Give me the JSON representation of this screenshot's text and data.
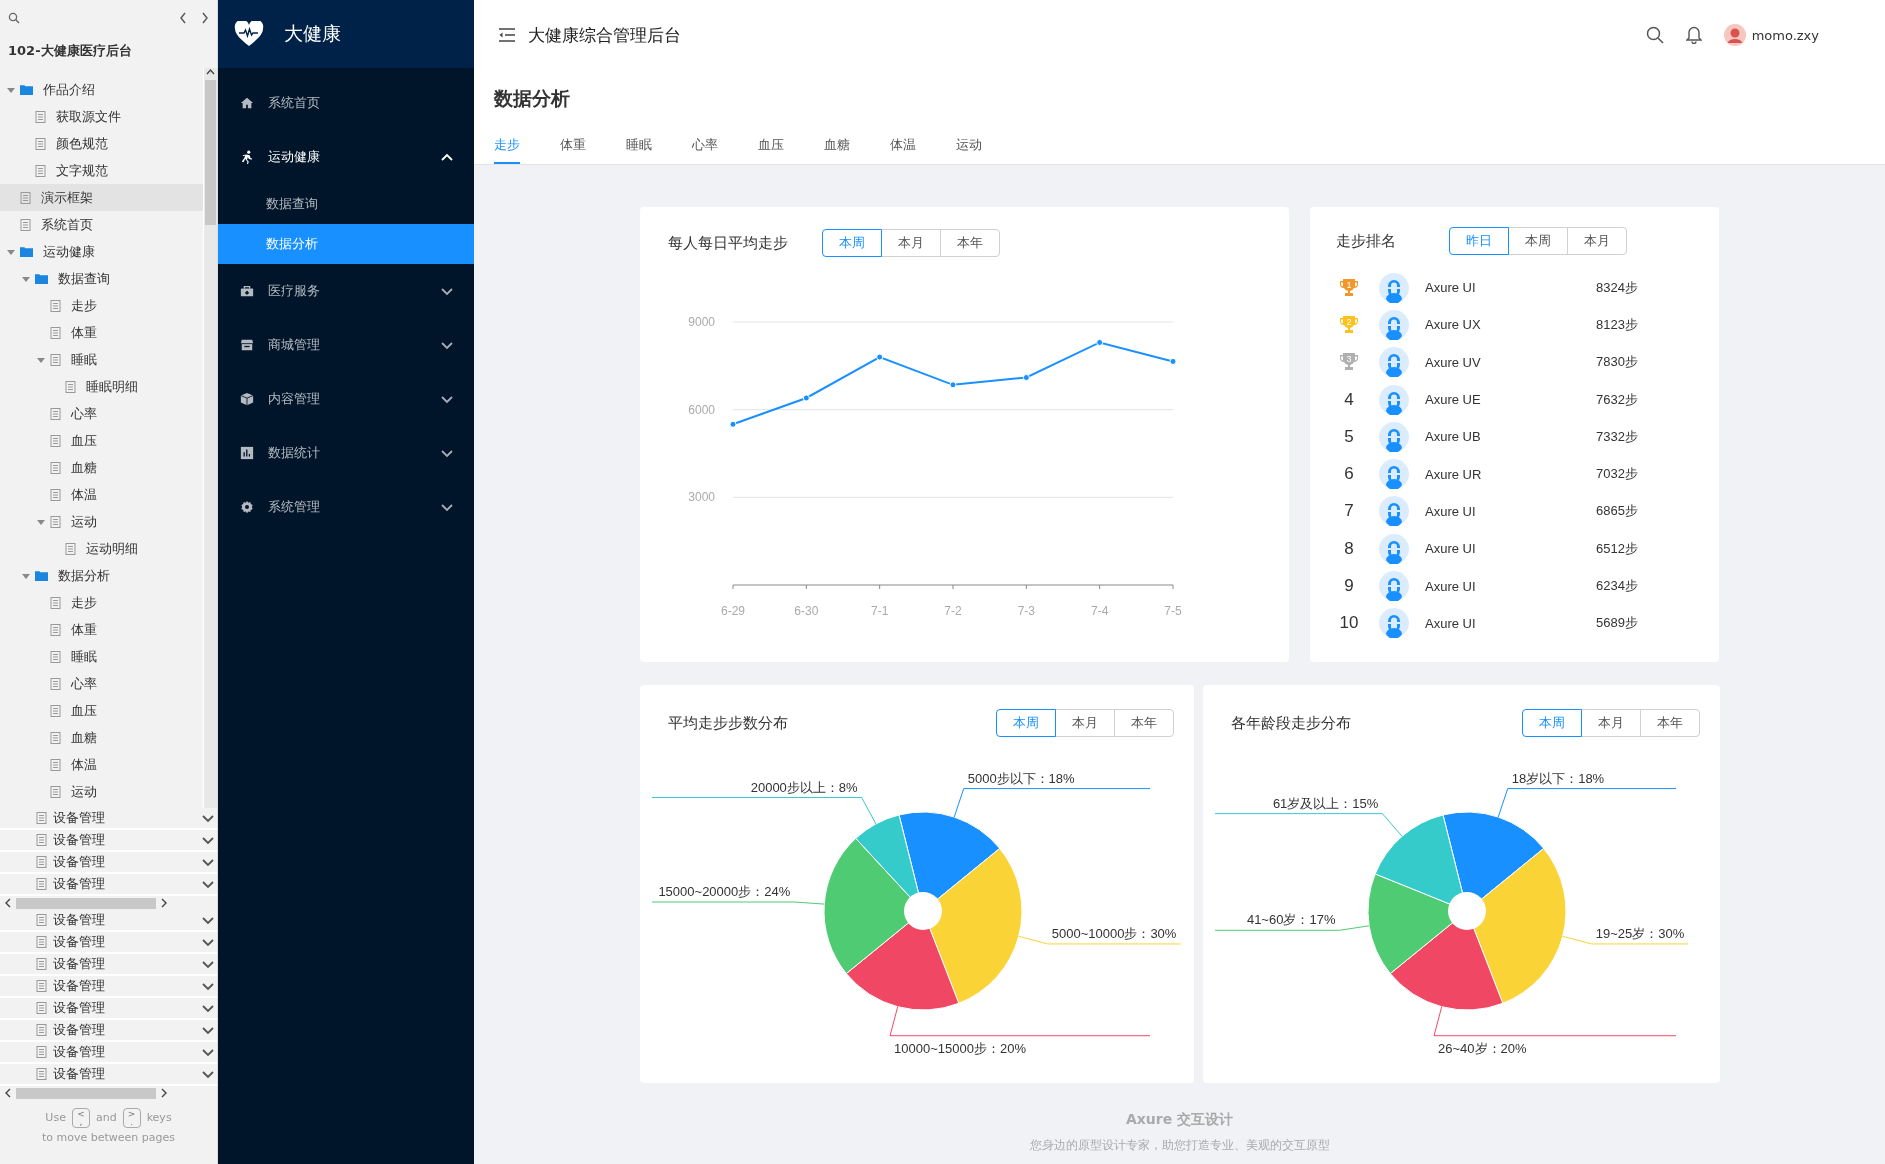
{
  "sidebar": {
    "project": "102-大健康医疗后台",
    "tree": [
      {
        "label": "作品介绍",
        "kind": "folder",
        "expanded": true,
        "selected": false,
        "children": [
          {
            "label": "获取源文件",
            "kind": "page",
            "selected": false
          },
          {
            "label": "颜色规范",
            "kind": "page",
            "selected": false
          },
          {
            "label": "文字规范",
            "kind": "page",
            "selected": false
          }
        ]
      },
      {
        "label": "演示框架",
        "kind": "page",
        "selected": true
      },
      {
        "label": "系统首页",
        "kind": "page",
        "selected": false
      },
      {
        "label": "运动健康",
        "kind": "folder",
        "expanded": true,
        "selected": false,
        "children": [
          {
            "label": "数据查询",
            "kind": "folder",
            "expanded": true,
            "selected": false,
            "children": [
              {
                "label": "走步",
                "kind": "page",
                "selected": false
              },
              {
                "label": "体重",
                "kind": "page",
                "selected": false
              },
              {
                "label": "睡眠",
                "kind": "page",
                "expanded": true,
                "selected": false,
                "children": [
                  {
                    "label": "睡眠明细",
                    "kind": "page",
                    "selected": false
                  }
                ]
              },
              {
                "label": "心率",
                "kind": "page",
                "selected": false
              },
              {
                "label": "血压",
                "kind": "page",
                "selected": false
              },
              {
                "label": "血糖",
                "kind": "page",
                "selected": false
              },
              {
                "label": "体温",
                "kind": "page",
                "selected": false
              },
              {
                "label": "运动",
                "kind": "page",
                "expanded": true,
                "selected": false,
                "children": [
                  {
                    "label": "运动明细",
                    "kind": "page",
                    "selected": false
                  }
                ]
              }
            ]
          },
          {
            "label": "数据分析",
            "kind": "folder",
            "expanded": true,
            "selected": false,
            "children": [
              {
                "label": "走步",
                "kind": "page",
                "selected": false
              },
              {
                "label": "体重",
                "kind": "page",
                "selected": false
              },
              {
                "label": "睡眠",
                "kind": "page",
                "selected": false
              },
              {
                "label": "心率",
                "kind": "page",
                "selected": false
              },
              {
                "label": "血压",
                "kind": "page",
                "selected": false
              },
              {
                "label": "血糖",
                "kind": "page",
                "selected": false
              },
              {
                "label": "体温",
                "kind": "page",
                "selected": false
              },
              {
                "label": "运动",
                "kind": "page",
                "selected": false
              }
            ]
          }
        ]
      }
    ],
    "device_rows": [
      {
        "label": "设备管理"
      },
      {
        "label": "设备管理"
      },
      {
        "label": "设备管理"
      },
      {
        "label": "设备管理"
      },
      {
        "label": "设备管理"
      },
      {
        "label": "设备管理"
      },
      {
        "label": "设备管理"
      },
      {
        "label": "设备管理"
      },
      {
        "label": "设备管理"
      },
      {
        "label": "设备管理"
      },
      {
        "label": "设备管理"
      },
      {
        "label": "设备管理"
      }
    ],
    "hint": {
      "words": [
        "Use",
        "and",
        "keys"
      ],
      "keys": [
        [
          "<",
          ","
        ],
        [
          ">",
          "."
        ]
      ],
      "line2": "to move between pages"
    }
  },
  "nav": {
    "brand": "大健康",
    "items": [
      {
        "label": "系统首页",
        "selected": false
      },
      {
        "label": "运动健康",
        "expanded": true,
        "selected": false,
        "children": [
          {
            "label": "数据查询",
            "selected": false
          },
          {
            "label": "数据分析",
            "selected": true
          }
        ]
      },
      {
        "label": "医疗服务",
        "expanded": false,
        "selected": false
      },
      {
        "label": "商城管理",
        "expanded": false,
        "selected": false
      },
      {
        "label": "内容管理",
        "expanded": false,
        "selected": false
      },
      {
        "label": "数据统计",
        "expanded": false,
        "selected": false
      },
      {
        "label": "系统管理",
        "expanded": false,
        "selected": false
      }
    ]
  },
  "header": {
    "title": "大健康综合管理后台",
    "user": "momo.zxy"
  },
  "page": {
    "title": "数据分析",
    "tabs": [
      {
        "label": "走步",
        "selected": true
      },
      {
        "label": "体重",
        "selected": false
      },
      {
        "label": "睡眠",
        "selected": false
      },
      {
        "label": "心率",
        "selected": false
      },
      {
        "label": "血压",
        "selected": false
      },
      {
        "label": "血糖",
        "selected": false
      },
      {
        "label": "体温",
        "selected": false
      },
      {
        "label": "运动",
        "selected": false
      }
    ]
  },
  "line_card": {
    "title": "每人每日平均走步",
    "periods": [
      {
        "label": "本周",
        "selected": true
      },
      {
        "label": "本月",
        "selected": false
      },
      {
        "label": "本年",
        "selected": false
      }
    ],
    "chart_data": {
      "type": "line",
      "categories": [
        "6-29",
        "6-30",
        "7-1",
        "7-2",
        "7-3",
        "7-4",
        "7-5"
      ],
      "ylim": [
        0,
        9000
      ],
      "yticks": [
        3000,
        6000,
        9000
      ],
      "series": [
        {
          "color": "#1890ff",
          "marker": true,
          "values": [
            5500,
            6400,
            7800,
            6850,
            7100,
            8300,
            7650
          ]
        }
      ]
    }
  },
  "ranking": {
    "title": "走步排名",
    "periods": [
      {
        "label": "昨日",
        "selected": true
      },
      {
        "label": "本周",
        "selected": false
      },
      {
        "label": "本月",
        "selected": false
      }
    ],
    "rows": [
      {
        "rank": "1",
        "kind": "trophy",
        "color": "#f5962a",
        "name": "Axure UI",
        "steps": "8324步"
      },
      {
        "rank": "2",
        "kind": "trophy",
        "color": "#fbc21e",
        "name": "Axure UX",
        "steps": "8123步"
      },
      {
        "rank": "3",
        "kind": "trophy",
        "color": "#b0b0b0",
        "name": "Axure UV",
        "steps": "7830步"
      },
      {
        "rank": "4",
        "kind": "number",
        "name": "Axure UE",
        "steps": "7632步"
      },
      {
        "rank": "5",
        "kind": "number",
        "name": "Axure UB",
        "steps": "7332步"
      },
      {
        "rank": "6",
        "kind": "number",
        "name": "Axure UR",
        "steps": "7032步"
      },
      {
        "rank": "7",
        "kind": "number",
        "name": "Axure UI",
        "steps": "6865步"
      },
      {
        "rank": "8",
        "kind": "number",
        "name": "Axure UI",
        "steps": "6512步"
      },
      {
        "rank": "9",
        "kind": "number",
        "name": "Axure UI",
        "steps": "6234步"
      },
      {
        "rank": "10",
        "kind": "number",
        "name": "Axure UI",
        "steps": "5689步"
      }
    ]
  },
  "pies": [
    {
      "title": "平均走步步数分布",
      "periods": [
        {
          "label": "本周",
          "selected": true
        },
        {
          "label": "本月",
          "selected": false
        },
        {
          "label": "本年",
          "selected": false
        }
      ],
      "chart_data": {
        "type": "pie",
        "values": [
          18,
          30,
          20,
          24,
          8
        ],
        "colors": [
          "#1890ff",
          "#fad337",
          "#f04864",
          "#4ecb73",
          "#36cbcb"
        ],
        "value_labels": [
          "5000步以下：18%",
          "5000~10000步：30%",
          "10000~15000步：20%",
          "15000~20000步：24%",
          "20000步以上：8%"
        ]
      }
    },
    {
      "title": "各年龄段走步分布",
      "periods": [
        {
          "label": "本周",
          "selected": true
        },
        {
          "label": "本月",
          "selected": false
        },
        {
          "label": "本年",
          "selected": false
        }
      ],
      "chart_data": {
        "type": "pie",
        "values": [
          18,
          30,
          20,
          17,
          15
        ],
        "colors": [
          "#1890ff",
          "#fad337",
          "#f04864",
          "#4ecb73",
          "#36cbcb"
        ],
        "value_labels": [
          "18岁以下：18%",
          "19~25岁：30%",
          "26~40岁：20%",
          "41~60岁：17%",
          "61岁及以上：15%"
        ]
      }
    }
  ],
  "footer": {
    "brand": "Axure 交互设计",
    "slogan": "您身边的原型设计专家，助您打造专业、美观的交互原型"
  }
}
